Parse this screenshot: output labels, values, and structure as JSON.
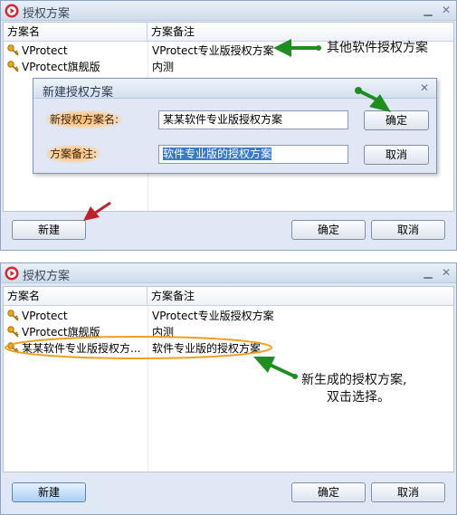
{
  "window1": {
    "title": "授权方案",
    "columns": [
      "方案名",
      "方案备注"
    ],
    "rows": [
      {
        "name": "VProtect",
        "note": "VProtect专业版授权方案"
      },
      {
        "name": "VProtect旗舰版",
        "note": "内测"
      }
    ],
    "buttons": {
      "new": "新建",
      "ok": "确定",
      "cancel": "取消"
    },
    "dialog": {
      "title": "新建授权方案",
      "name_label": "新授权方案名:",
      "name_value": "某某软件专业版授权方案",
      "note_label": "方案备注:",
      "note_value": "软件专业版的授权方案",
      "ok": "确定",
      "cancel": "取消"
    },
    "annotation": "其他软件授权方案"
  },
  "window2": {
    "title": "授权方案",
    "columns": [
      "方案名",
      "方案备注"
    ],
    "rows": [
      {
        "name": "VProtect",
        "note": "VProtect专业版授权方案"
      },
      {
        "name": "VProtect旗舰版",
        "note": "内测"
      },
      {
        "name": "某某软件专业版授权方...",
        "note": "软件专业版的授权方案"
      }
    ],
    "buttons": {
      "new": "新建",
      "ok": "确定",
      "cancel": "取消"
    },
    "annotation_line1": "新生成的授权方案,",
    "annotation_line2": "双击选择。"
  },
  "colors": {
    "window_bg": "#dfe8f4",
    "arrow_green": "#1e8f1e",
    "arrow_red": "#c0202a",
    "highlight_orange": "#f0a020",
    "selection_blue": "#3a78c9"
  },
  "icons": {
    "app": "red-circle-play-icon",
    "row": "key-icon",
    "min": "minimize-icon",
    "close": "close-icon"
  }
}
